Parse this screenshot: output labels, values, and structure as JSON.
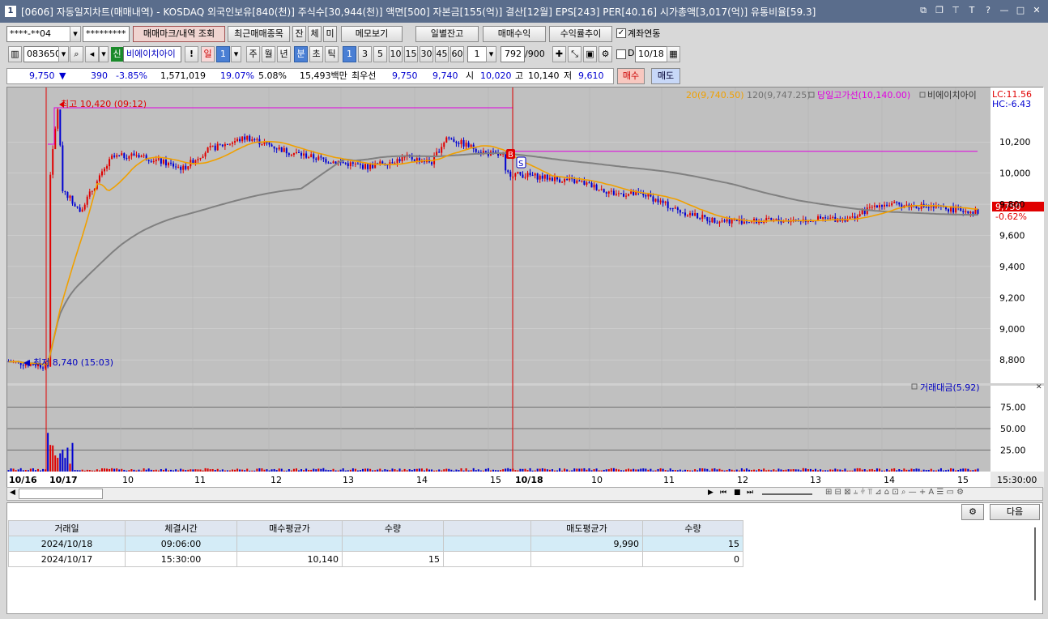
{
  "window": {
    "title": "[0606] 자동일지차트(매매내역) - KOSDAQ 외국인보유[840(천)] 주식수[30,944(천)] 액면[500] 자본금[155(억)] 결산[12월] EPS[243] PER[40.16] 시가총액[3,017(억)] 유통비율[59.3]",
    "app_number": "1"
  },
  "toolbar1": {
    "account": "****-**04",
    "password": "*********",
    "trade_mark_btn": "매매마크/내역 조회",
    "recent_btn": "최근매매종목",
    "tab_jan": "잔",
    "tab_che": "체",
    "tab_mi": "미",
    "memo_btn": "메모보기",
    "daily_balance_btn": "일별잔고",
    "trade_profit_btn": "매매수익",
    "return_trend_btn": "수익률추이",
    "account_link_label": "계좌연동",
    "account_link_checked": true
  },
  "toolbar2": {
    "code": "083650",
    "credit_badge": "신",
    "stock_name": "비에이치아이",
    "period_day": "일",
    "period_num": "1",
    "period_week": "주",
    "period_month": "월",
    "period_year": "년",
    "period_min": "분",
    "period_sec": "초",
    "period_tick": "틱",
    "intervals": [
      "1",
      "3",
      "5",
      "10",
      "15",
      "30",
      "45",
      "60"
    ],
    "interval_value": "1",
    "count_value": "792",
    "count_total": "/900",
    "d_label": "D",
    "date_value": "10/18"
  },
  "quote": {
    "price": "9,750",
    "change": "390",
    "change_pct": "-3.85%",
    "volume": "1,571,019",
    "turnover_pct": "19.07%",
    "rate2": "5.08%",
    "amount": "15,493백만",
    "best_label": "최우선",
    "best_ask": "9,750",
    "best_bid": "9,740",
    "open_label": "시",
    "open": "10,020",
    "high_label": "고",
    "high": "10,140",
    "low_label": "저",
    "low": "9,610",
    "buy_btn": "매수",
    "sell_btn": "매도"
  },
  "chart": {
    "legend_ma20": "20(9,740.50)",
    "legend_ma120": "120(9,747.25)",
    "legend_dayhigh": "당일고가선(10,140.00)",
    "legend_name": "비에이치아이",
    "lc": "LC:11.56",
    "hc": "HC:-6.43",
    "high_label": "최고 10,420 (09:12)",
    "low_label": "최저 8,740 (15:03)",
    "current_price_tag": "9,750",
    "current_pct_tag": "-0.62%",
    "buy_marker": "B",
    "sell_marker": "S",
    "volume_legend": "거래대금(5.92)",
    "price_ticks": [
      "10,200",
      "10,000",
      "9,800",
      "9,600",
      "9,400",
      "9,200",
      "9,000",
      "8,800"
    ],
    "volume_ticks": [
      "75.00",
      "50.00",
      "25.00"
    ],
    "x_labels": [
      "10/16",
      "10/17",
      "10",
      "11",
      "12",
      "13",
      "14",
      "15",
      "10/18",
      "10",
      "11",
      "12",
      "13",
      "14",
      "15"
    ],
    "last_time": "15:30:00",
    "colors": {
      "ma20": "#f0a000",
      "ma120": "#808080",
      "up": "#e00000",
      "down": "#0000d0",
      "dayhigh": "#e000e0"
    }
  },
  "chart_data": {
    "type": "line",
    "title": "",
    "xlabel": "",
    "ylabel": "",
    "ylim": [
      8650,
      10550
    ],
    "series": [
      {
        "name": "20",
        "last": 9740.5
      },
      {
        "name": "120",
        "last": 9747.25
      },
      {
        "name": "당일고가선",
        "value": 10140.0
      }
    ],
    "high": {
      "value": 10420,
      "time": "09:12"
    },
    "low": {
      "value": 8740,
      "time": "15:03"
    },
    "close": 9750
  },
  "panel": {
    "next_btn": "다음",
    "headers": [
      "거래일",
      "체결시간",
      "매수평균가",
      "수량",
      "",
      "매도평균가",
      "수량"
    ],
    "rows": [
      [
        "2024/10/18",
        "09:06:00",
        "",
        "",
        "",
        "9,990",
        "15"
      ],
      [
        "2024/10/17",
        "15:30:00",
        "10,140",
        "15",
        "",
        "",
        "0"
      ]
    ]
  }
}
